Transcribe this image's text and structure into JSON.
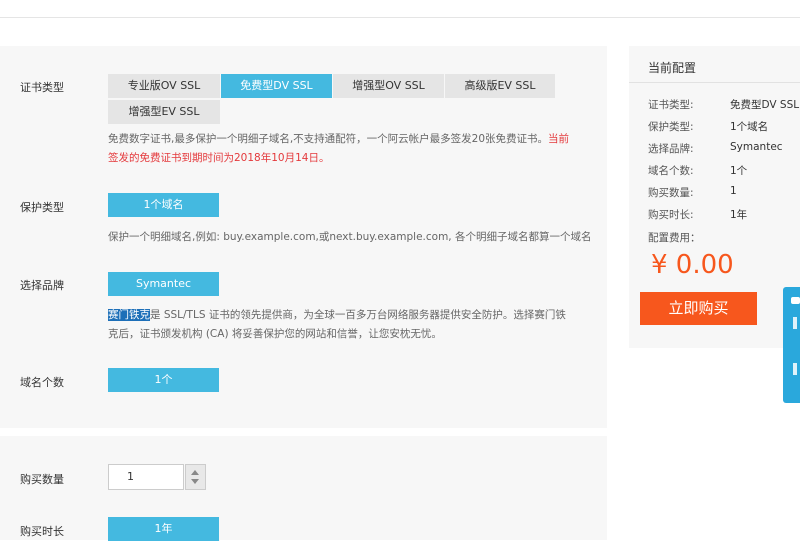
{
  "form": {
    "cert_type": {
      "label": "证书类型",
      "options": [
        "专业版OV SSL",
        "免费型DV SSL",
        "增强型OV SSL",
        "高级版EV SSL",
        "增强型EV SSL"
      ],
      "selected": "免费型DV SSL",
      "desc_normal": "免费数字证书,最多保护一个明细子域名,不支持通配符，一个阿云帐户最多签发20张免费证书。",
      "desc_red_1": "当前",
      "desc_red_2": "签发的免费证书到期时间为2018年10月14日。"
    },
    "protect_type": {
      "label": "保护类型",
      "option": "1个域名",
      "desc": "保护一个明细域名,例如: buy.example.com,或next.buy.example.com, 各个明细子域名都算一个域名"
    },
    "brand": {
      "label": "选择品牌",
      "option": "Symantec",
      "desc_highlight": "赛门铁克",
      "desc_rest_1": "是 SSL/TLS 证书的领先提供商，为全球一百多万台网络服务器提供安全防护。选择赛门铁",
      "desc_rest_2": "克后，证书颁发机构 (CA) 将妥善保护您的网站和信誉，让您安枕无忧。"
    },
    "domain_count": {
      "label": "域名个数",
      "option": "1个"
    },
    "quantity": {
      "label": "购买数量",
      "value": "1"
    },
    "duration": {
      "label": "购买时长",
      "option": "1年"
    }
  },
  "summary": {
    "title": "当前配置",
    "rows": [
      {
        "key": "证书类型:",
        "value": "免费型DV SSL"
      },
      {
        "key": "保护类型:",
        "value": "1个域名"
      },
      {
        "key": "选择品牌:",
        "value": "Symantec"
      },
      {
        "key": "域名个数:",
        "value": "1个"
      },
      {
        "key": "购买数量:",
        "value": "1"
      },
      {
        "key": "购买时长:",
        "value": "1年"
      }
    ],
    "fee_label": "配置费用：",
    "price": "¥ 0.00",
    "buy_label": "立即购买"
  },
  "colors": {
    "accent": "#44b9e0",
    "orange": "#f7571d",
    "red": "#e4393c"
  }
}
